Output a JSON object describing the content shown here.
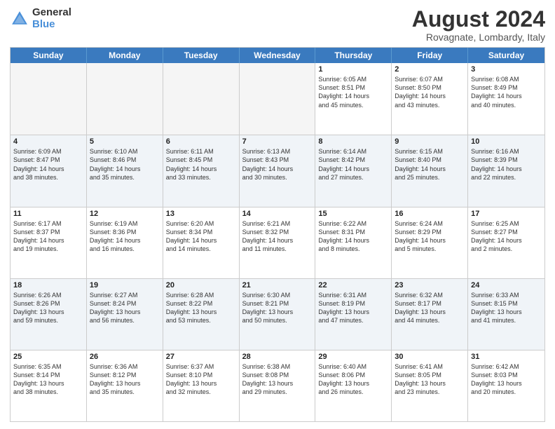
{
  "logo": {
    "line1": "General",
    "line2": "Blue"
  },
  "title": "August 2024",
  "location": "Rovagnate, Lombardy, Italy",
  "days": [
    "Sunday",
    "Monday",
    "Tuesday",
    "Wednesday",
    "Thursday",
    "Friday",
    "Saturday"
  ],
  "rows": [
    [
      {
        "day": "",
        "text": "",
        "empty": true
      },
      {
        "day": "",
        "text": "",
        "empty": true
      },
      {
        "day": "",
        "text": "",
        "empty": true
      },
      {
        "day": "",
        "text": "",
        "empty": true
      },
      {
        "day": "1",
        "text": "Sunrise: 6:05 AM\nSunset: 8:51 PM\nDaylight: 14 hours\nand 45 minutes."
      },
      {
        "day": "2",
        "text": "Sunrise: 6:07 AM\nSunset: 8:50 PM\nDaylight: 14 hours\nand 43 minutes."
      },
      {
        "day": "3",
        "text": "Sunrise: 6:08 AM\nSunset: 8:49 PM\nDaylight: 14 hours\nand 40 minutes."
      }
    ],
    [
      {
        "day": "4",
        "text": "Sunrise: 6:09 AM\nSunset: 8:47 PM\nDaylight: 14 hours\nand 38 minutes."
      },
      {
        "day": "5",
        "text": "Sunrise: 6:10 AM\nSunset: 8:46 PM\nDaylight: 14 hours\nand 35 minutes."
      },
      {
        "day": "6",
        "text": "Sunrise: 6:11 AM\nSunset: 8:45 PM\nDaylight: 14 hours\nand 33 minutes."
      },
      {
        "day": "7",
        "text": "Sunrise: 6:13 AM\nSunset: 8:43 PM\nDaylight: 14 hours\nand 30 minutes."
      },
      {
        "day": "8",
        "text": "Sunrise: 6:14 AM\nSunset: 8:42 PM\nDaylight: 14 hours\nand 27 minutes."
      },
      {
        "day": "9",
        "text": "Sunrise: 6:15 AM\nSunset: 8:40 PM\nDaylight: 14 hours\nand 25 minutes."
      },
      {
        "day": "10",
        "text": "Sunrise: 6:16 AM\nSunset: 8:39 PM\nDaylight: 14 hours\nand 22 minutes."
      }
    ],
    [
      {
        "day": "11",
        "text": "Sunrise: 6:17 AM\nSunset: 8:37 PM\nDaylight: 14 hours\nand 19 minutes."
      },
      {
        "day": "12",
        "text": "Sunrise: 6:19 AM\nSunset: 8:36 PM\nDaylight: 14 hours\nand 16 minutes."
      },
      {
        "day": "13",
        "text": "Sunrise: 6:20 AM\nSunset: 8:34 PM\nDaylight: 14 hours\nand 14 minutes."
      },
      {
        "day": "14",
        "text": "Sunrise: 6:21 AM\nSunset: 8:32 PM\nDaylight: 14 hours\nand 11 minutes."
      },
      {
        "day": "15",
        "text": "Sunrise: 6:22 AM\nSunset: 8:31 PM\nDaylight: 14 hours\nand 8 minutes."
      },
      {
        "day": "16",
        "text": "Sunrise: 6:24 AM\nSunset: 8:29 PM\nDaylight: 14 hours\nand 5 minutes."
      },
      {
        "day": "17",
        "text": "Sunrise: 6:25 AM\nSunset: 8:27 PM\nDaylight: 14 hours\nand 2 minutes."
      }
    ],
    [
      {
        "day": "18",
        "text": "Sunrise: 6:26 AM\nSunset: 8:26 PM\nDaylight: 13 hours\nand 59 minutes."
      },
      {
        "day": "19",
        "text": "Sunrise: 6:27 AM\nSunset: 8:24 PM\nDaylight: 13 hours\nand 56 minutes."
      },
      {
        "day": "20",
        "text": "Sunrise: 6:28 AM\nSunset: 8:22 PM\nDaylight: 13 hours\nand 53 minutes."
      },
      {
        "day": "21",
        "text": "Sunrise: 6:30 AM\nSunset: 8:21 PM\nDaylight: 13 hours\nand 50 minutes."
      },
      {
        "day": "22",
        "text": "Sunrise: 6:31 AM\nSunset: 8:19 PM\nDaylight: 13 hours\nand 47 minutes."
      },
      {
        "day": "23",
        "text": "Sunrise: 6:32 AM\nSunset: 8:17 PM\nDaylight: 13 hours\nand 44 minutes."
      },
      {
        "day": "24",
        "text": "Sunrise: 6:33 AM\nSunset: 8:15 PM\nDaylight: 13 hours\nand 41 minutes."
      }
    ],
    [
      {
        "day": "25",
        "text": "Sunrise: 6:35 AM\nSunset: 8:14 PM\nDaylight: 13 hours\nand 38 minutes."
      },
      {
        "day": "26",
        "text": "Sunrise: 6:36 AM\nSunset: 8:12 PM\nDaylight: 13 hours\nand 35 minutes."
      },
      {
        "day": "27",
        "text": "Sunrise: 6:37 AM\nSunset: 8:10 PM\nDaylight: 13 hours\nand 32 minutes."
      },
      {
        "day": "28",
        "text": "Sunrise: 6:38 AM\nSunset: 8:08 PM\nDaylight: 13 hours\nand 29 minutes."
      },
      {
        "day": "29",
        "text": "Sunrise: 6:40 AM\nSunset: 8:06 PM\nDaylight: 13 hours\nand 26 minutes."
      },
      {
        "day": "30",
        "text": "Sunrise: 6:41 AM\nSunset: 8:05 PM\nDaylight: 13 hours\nand 23 minutes."
      },
      {
        "day": "31",
        "text": "Sunrise: 6:42 AM\nSunset: 8:03 PM\nDaylight: 13 hours\nand 20 minutes."
      }
    ]
  ]
}
